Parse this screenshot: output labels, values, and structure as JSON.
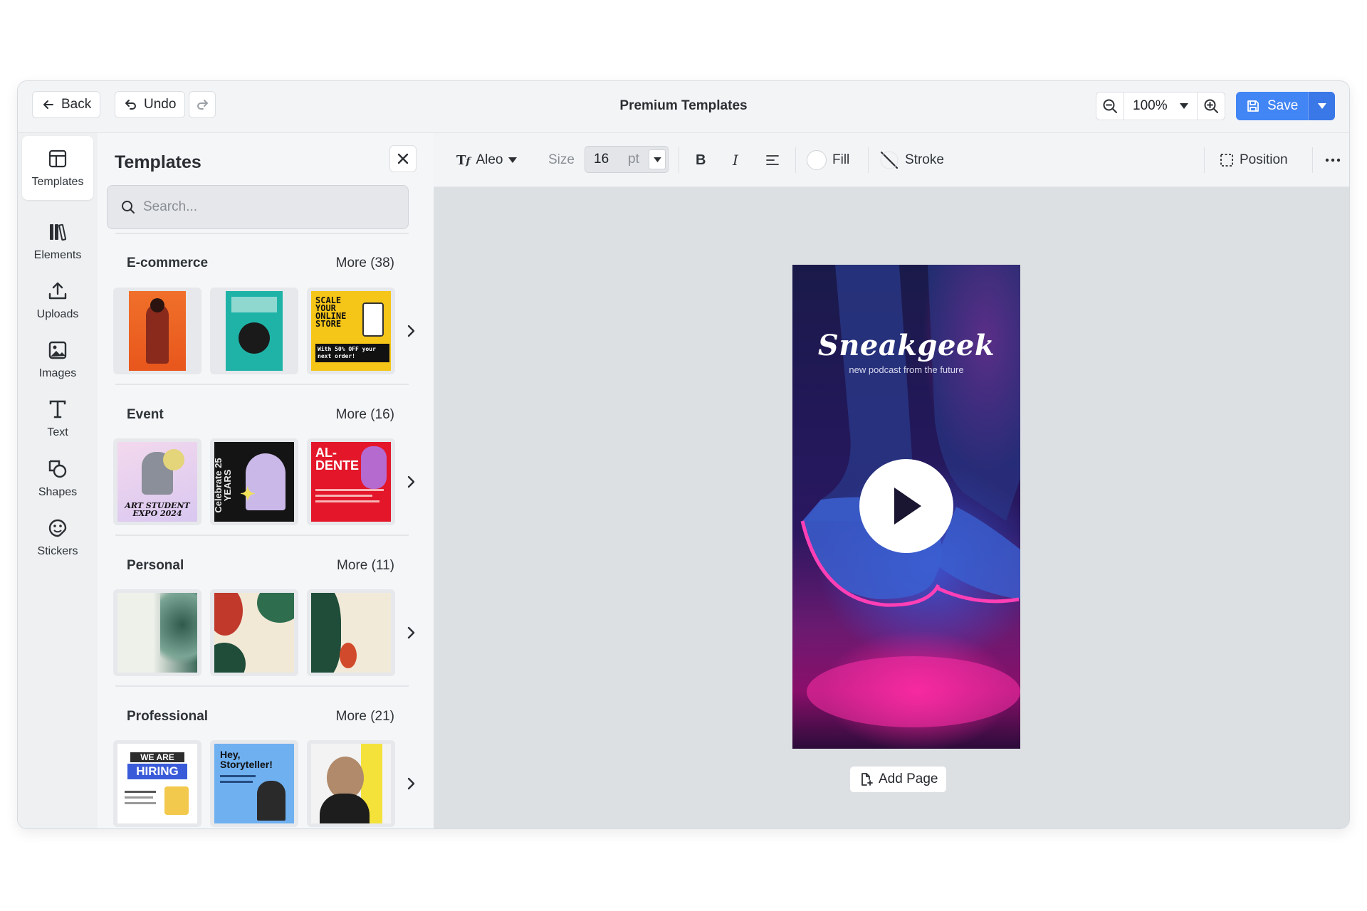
{
  "topbar": {
    "back_label": "Back",
    "undo_label": "Undo",
    "title": "Premium Templates",
    "zoom": "100%",
    "save_label": "Save"
  },
  "rail": {
    "items": [
      {
        "label": "Templates",
        "icon": "layout-icon",
        "active": true
      },
      {
        "label": "Elements",
        "icon": "elements-icon"
      },
      {
        "label": "Uploads",
        "icon": "upload-icon"
      },
      {
        "label": "Images",
        "icon": "image-icon"
      },
      {
        "label": "Text",
        "icon": "text-icon"
      },
      {
        "label": "Shapes",
        "icon": "shapes-icon"
      },
      {
        "label": "Stickers",
        "icon": "sticker-icon"
      }
    ]
  },
  "panel": {
    "title": "Templates",
    "search_placeholder": "Search...",
    "categories": [
      {
        "name": "E-commerce",
        "more": "More (38)"
      },
      {
        "name": "Event",
        "more": "More (16)"
      },
      {
        "name": "Personal",
        "more": "More (11)"
      },
      {
        "name": "Professional",
        "more": "More (21)"
      }
    ],
    "thumb_text": {
      "ecom3_a": "SCALE YOUR ONLINE STORE",
      "ecom3_b": "With 50% OFF your next order!",
      "event1": "ART STUDENT EXPO 2024",
      "event2": "Celebrate 25 YEARS",
      "event3": "AL- DENTE",
      "pro1_a": "WE ARE",
      "pro1_b": "HIRING",
      "pro2": "Hey, Storyteller!"
    }
  },
  "toolbar": {
    "font": "Aleo",
    "size_label": "Size",
    "size_value": "16",
    "size_unit": "pt",
    "fill_label": "Fill",
    "stroke_label": "Stroke",
    "position_label": "Position"
  },
  "design": {
    "title": "Sneakgeek",
    "subtitle": "new podcast from the future"
  },
  "canvas": {
    "add_page_label": "Add Page"
  },
  "colors": {
    "accent": "#4285f4",
    "canvas_bg": "#dde0e3"
  }
}
